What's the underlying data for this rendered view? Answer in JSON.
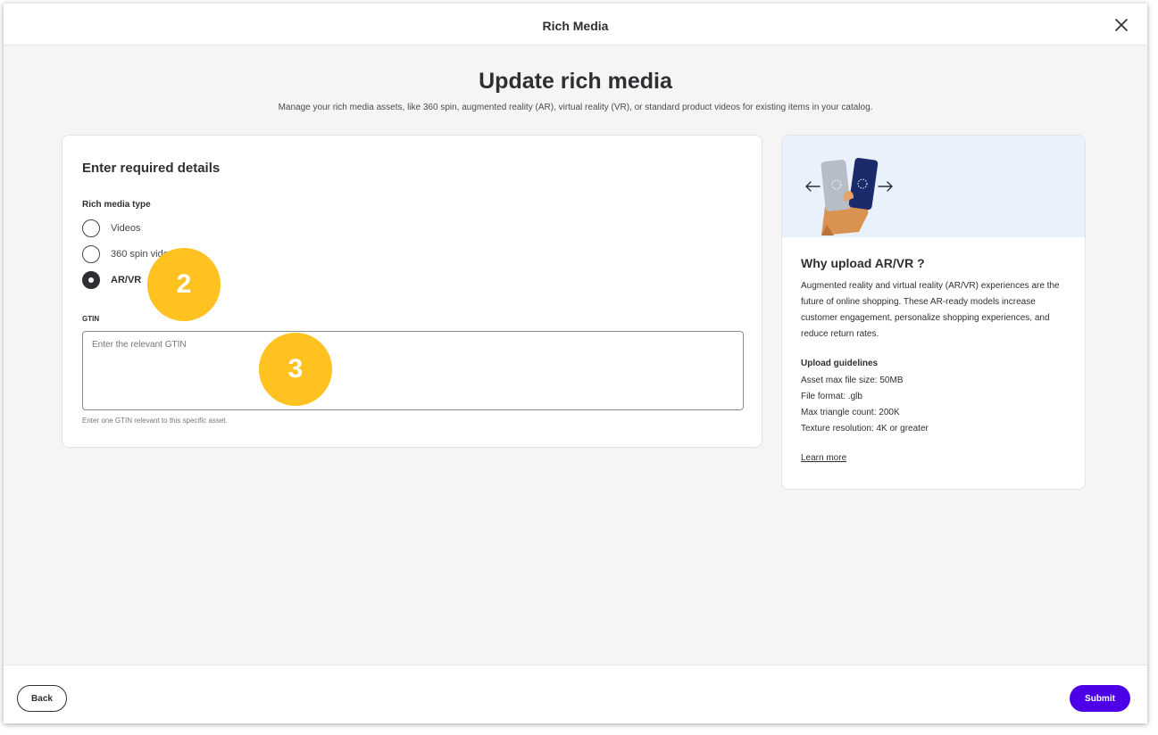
{
  "header": {
    "title": "Rich Media",
    "close_icon": "close-icon"
  },
  "page": {
    "heading": "Update rich media",
    "subheading": "Manage your rich media assets, like 360 spin, augmented reality (AR), virtual reality (VR), or standard product videos for existing items in your catalog."
  },
  "form": {
    "title": "Enter required details",
    "media_type_label": "Rich media type",
    "options": [
      {
        "label": "Videos",
        "selected": false
      },
      {
        "label": "360 spin video",
        "selected": false
      },
      {
        "label": "AR/VR",
        "selected": true
      }
    ],
    "gtin_label": "GTIN",
    "gtin_placeholder": "Enter the relevant GTIN",
    "gtin_value": "",
    "gtin_helper": "Enter one GTIN relevant to this specific asset."
  },
  "callouts": [
    "2",
    "3"
  ],
  "side": {
    "title": "Why upload AR/VR ?",
    "body": "Augmented reality and virtual reality (AR/VR) experiences are the future of online shopping. These AR-ready models increase customer engagement, personalize shopping experiences, and reduce return rates.",
    "guidelines_title": "Upload guidelines",
    "guidelines": [
      "Asset max file size: 50MB",
      "File format: .glb",
      "Max triangle count: 200K",
      "Texture resolution: 4K or greater"
    ],
    "learn_more": "Learn more",
    "illustration": "phones-in-hand-illustration"
  },
  "footer": {
    "back_label": "Back",
    "submit_label": "Submit"
  },
  "colors": {
    "accent": "#4d00e8",
    "callout": "#ffc220",
    "banner": "#e9f1fd"
  }
}
